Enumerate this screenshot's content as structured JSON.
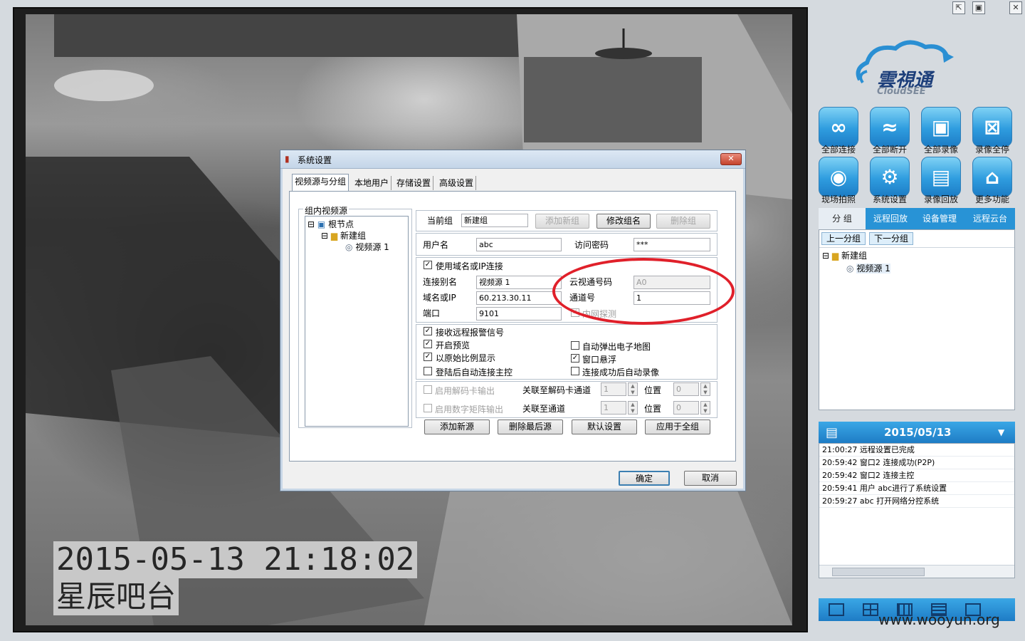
{
  "video": {
    "timestamp": "2015-05-13  21:18:02",
    "location": "星辰吧台"
  },
  "window_controls": [
    "⇱",
    "▣",
    "✕"
  ],
  "logo": {
    "title": "雲視通",
    "subtitle": "CloudSEE"
  },
  "toolbar": [
    {
      "label": "全部连接",
      "icon": "link-icon"
    },
    {
      "label": "全部断开",
      "icon": "unlink-icon"
    },
    {
      "label": "全部录像",
      "icon": "record-icon"
    },
    {
      "label": "录像全停",
      "icon": "record-stop-icon"
    },
    {
      "label": "现场拍照",
      "icon": "camera-icon"
    },
    {
      "label": "系统设置",
      "icon": "gear-icon"
    },
    {
      "label": "录像回放",
      "icon": "clapper-icon"
    },
    {
      "label": "更多功能",
      "icon": "more-icon"
    }
  ],
  "right_tabs": [
    "分 组",
    "远程回放",
    "设备管理",
    "远程云台"
  ],
  "group_panel": {
    "prev_btn": "上一分组",
    "next_btn": "下一分组",
    "tree_group": "新建组",
    "tree_source": "视频源 1"
  },
  "log": {
    "date": "2015/05/13",
    "entries": [
      "21:00:27 远程设置已完成",
      "20:59:42 窗口2 连接成功(P2P)",
      "20:59:42 窗口2 连接主控",
      "20:59:41 用户 abc进行了系统设置",
      "20:59:27 abc 打开网络分控系统"
    ]
  },
  "watermark": "www.wooyun.org",
  "dialog": {
    "title": "系统设置",
    "tabs": [
      "视频源与分组",
      "本地用户",
      "存储设置",
      "高级设置"
    ],
    "group_title": "组内视频源",
    "tree": {
      "root": "根节点",
      "group": "新建组",
      "source": "视频源 1"
    },
    "current_group_label": "当前组",
    "current_group_value": "新建组",
    "add_group": "添加新组",
    "rename_group": "修改组名",
    "delete_group": "删除组",
    "username_label": "用户名",
    "username_value": "abc",
    "password_label": "访问密码",
    "password_value": "***",
    "use_domain": "使用域名或IP连接",
    "alias_label": "连接别名",
    "alias_value": "视频源 1",
    "cloudsee_label": "云视通号码",
    "cloudsee_value": "A0",
    "host_label": "域名或IP",
    "host_value": "60.213.30.11",
    "channel_label": "通道号",
    "channel_value": "1",
    "port_label": "端口",
    "port_value": "9101",
    "lan_probe": "内网探测",
    "recv_alarm": "接收远程报警信号",
    "auto_map": "自动弹出电子地图",
    "open_preview": "开启预览",
    "float_window": "窗口悬浮",
    "orig_ratio": "以原始比例显示",
    "auto_connect": "登陆后自动连接主控",
    "auto_record": "连接成功后自动录像",
    "decode_output": "启用解码卡输出",
    "decode_link": "关联至解码卡通道",
    "decode_ch": "1",
    "pos_label": "位置",
    "decode_pos": "0",
    "matrix_output": "启用数字矩阵输出",
    "matrix_link": "关联至通道",
    "matrix_ch": "1",
    "matrix_pos": "0",
    "add_source": "添加新源",
    "delete_last": "删除最后源",
    "default_settings": "默认设置",
    "apply_all": "应用于全组",
    "ok": "确定",
    "cancel": "取消"
  }
}
